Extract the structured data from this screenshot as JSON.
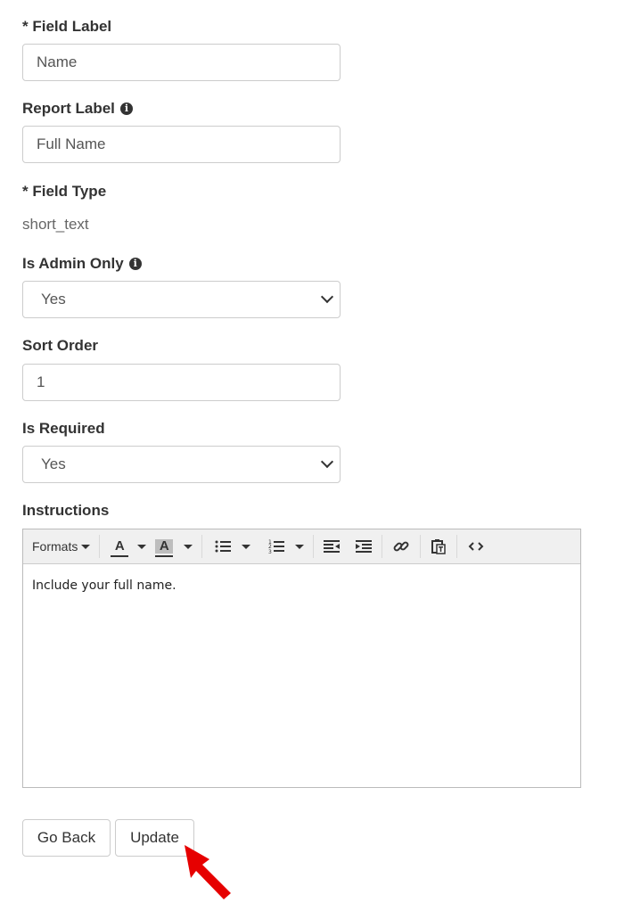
{
  "form": {
    "field_label": {
      "label": "* Field Label",
      "value": "Name"
    },
    "report_label": {
      "label": "Report Label",
      "value": "Full Name"
    },
    "field_type": {
      "label": "* Field Type",
      "value": "short_text"
    },
    "is_admin_only": {
      "label": "Is Admin Only",
      "value": "Yes"
    },
    "sort_order": {
      "label": "Sort Order",
      "value": "1"
    },
    "is_required": {
      "label": "Is Required",
      "value": "Yes"
    },
    "instructions": {
      "label": "Instructions",
      "toolbar": {
        "formats_label": "Formats"
      },
      "content": "Include your full name."
    }
  },
  "buttons": {
    "go_back": "Go Back",
    "update": "Update"
  },
  "icons": {
    "info": "info-circle-icon",
    "text_color": "text-color-icon",
    "background_color": "background-color-icon",
    "bullet_list": "bullet-list-icon",
    "numbered_list": "numbered-list-icon",
    "outdent": "outdent-icon",
    "indent": "indent-icon",
    "link": "link-icon",
    "paste": "paste-as-text-icon",
    "source_code": "source-code-icon",
    "cursor": "red-arrow-cursor-icon"
  },
  "colors": {
    "cursor": "#e60000"
  }
}
